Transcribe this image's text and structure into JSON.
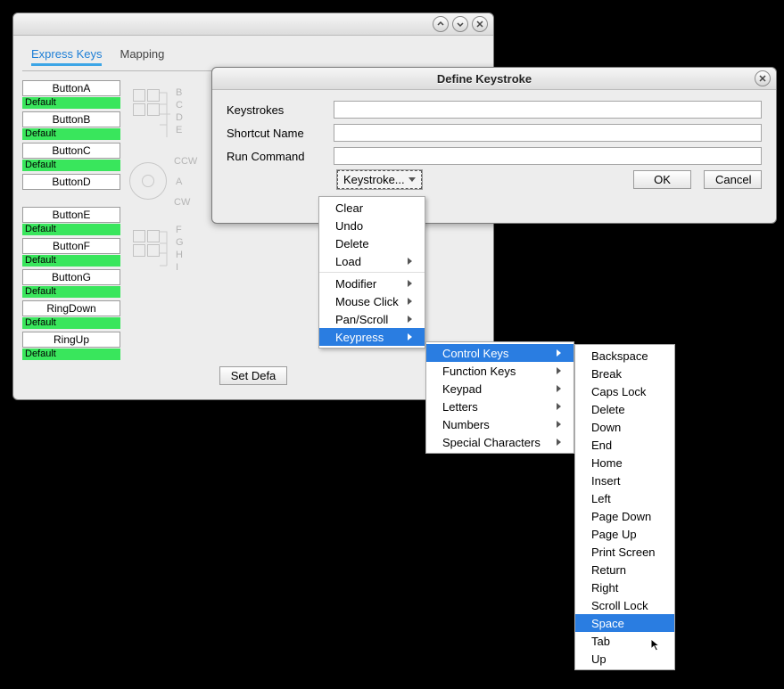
{
  "main": {
    "tabs": [
      {
        "label": "Express Keys",
        "active": true
      },
      {
        "label": "Mapping",
        "active": false
      }
    ],
    "buttons": [
      {
        "name": "ButtonA",
        "status": "Default"
      },
      {
        "name": "ButtonB",
        "status": "Default"
      },
      {
        "name": "ButtonC",
        "status": "Default"
      },
      {
        "name": "ButtonD",
        "status": ""
      },
      {
        "name": "ButtonE",
        "status": "Default"
      },
      {
        "name": "ButtonF",
        "status": "Default"
      },
      {
        "name": "ButtonG",
        "status": "Default"
      },
      {
        "name": "RingDown",
        "status": "Default"
      },
      {
        "name": "RingUp",
        "status": "Default"
      }
    ],
    "diagram": {
      "topLabels": [
        "B",
        "C",
        "D",
        "E"
      ],
      "ringLabels": {
        "ccw": "CCW",
        "cw": "CW",
        "a": "A"
      },
      "bottomLabels": [
        "F",
        "G",
        "H",
        "I"
      ]
    },
    "set_defaults": "Set Defa"
  },
  "dialog": {
    "title": "Define Keystroke",
    "fields": {
      "keystrokes_label": "Keystrokes",
      "shortcut_label": "Shortcut Name",
      "command_label": "Run Command",
      "keystrokes_value": "",
      "shortcut_value": "",
      "command_value": ""
    },
    "combo_label": "Keystroke...",
    "ok": "OK",
    "cancel": "Cancel"
  },
  "menu1": {
    "group1": [
      "Clear",
      "Undo",
      "Delete",
      "Load"
    ],
    "group2": [
      "Modifier",
      "Mouse Click",
      "Pan/Scroll",
      "Keypress"
    ]
  },
  "menu2": {
    "items": [
      "Control Keys",
      "Function Keys",
      "Keypad",
      "Letters",
      "Numbers",
      "Special Characters"
    ]
  },
  "menu3": {
    "items": [
      "Backspace",
      "Break",
      "Caps Lock",
      "Delete",
      "Down",
      "End",
      "Home",
      "Insert",
      "Left",
      "Page Down",
      "Page Up",
      "Print Screen",
      "Return",
      "Right",
      "Scroll Lock",
      "Space",
      "Tab",
      "Up"
    ]
  },
  "highlights": {
    "menu1": "Keypress",
    "menu2": "Control Keys",
    "menu3": "Space"
  }
}
